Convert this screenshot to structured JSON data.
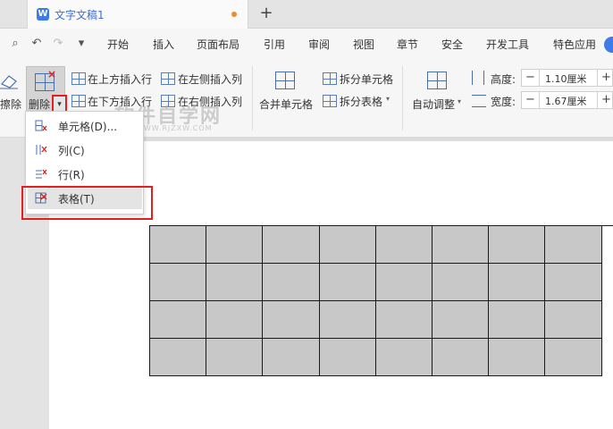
{
  "tab": {
    "icon_letter": "W",
    "title": "文字文稿1",
    "new_tab": "+"
  },
  "quick_access": {
    "preview": "⌕",
    "undo": "↶",
    "redo": "↷",
    "more": "▾"
  },
  "menu": [
    "开始",
    "插入",
    "页面布局",
    "引用",
    "审阅",
    "视图",
    "章节",
    "安全",
    "开发工具",
    "特色应用"
  ],
  "ribbon": {
    "eraser_label": "擦除",
    "delete_label": "删除",
    "delete_arrow": "▾",
    "insert_above": "在上方插入行",
    "insert_below": "在下方插入行",
    "insert_left": "在左侧插入列",
    "insert_right": "在右侧插入列",
    "merge_cells": "合并单元格",
    "split_cells": "拆分单元格",
    "split_table": "拆分表格",
    "split_table_arrow": "▾",
    "auto_fit": "自动调整",
    "auto_fit_arrow": "▾",
    "height_label": "高度:",
    "height_value": "1.10厘米",
    "width_label": "宽度:",
    "width_value": "1.67厘米",
    "minus": "−",
    "plus": "+"
  },
  "dropdown": {
    "items": [
      {
        "label": "单元格(D)...",
        "icon": "delete-cell-icon"
      },
      {
        "label": "列(C)",
        "icon": "delete-column-icon"
      },
      {
        "label": "行(R)",
        "icon": "delete-row-icon"
      },
      {
        "label": "表格(T)",
        "icon": "delete-table-icon"
      }
    ]
  },
  "watermark": {
    "main": "软件自学网",
    "sub": "WWW.RJZXW.COM"
  },
  "table": {
    "rows": 4,
    "columns": 8
  },
  "colors": {
    "accent": "#3d7be8",
    "highlight": "#e02020",
    "cell_fill": "#c8c8c8",
    "modified_dot": "#f08a2b"
  }
}
